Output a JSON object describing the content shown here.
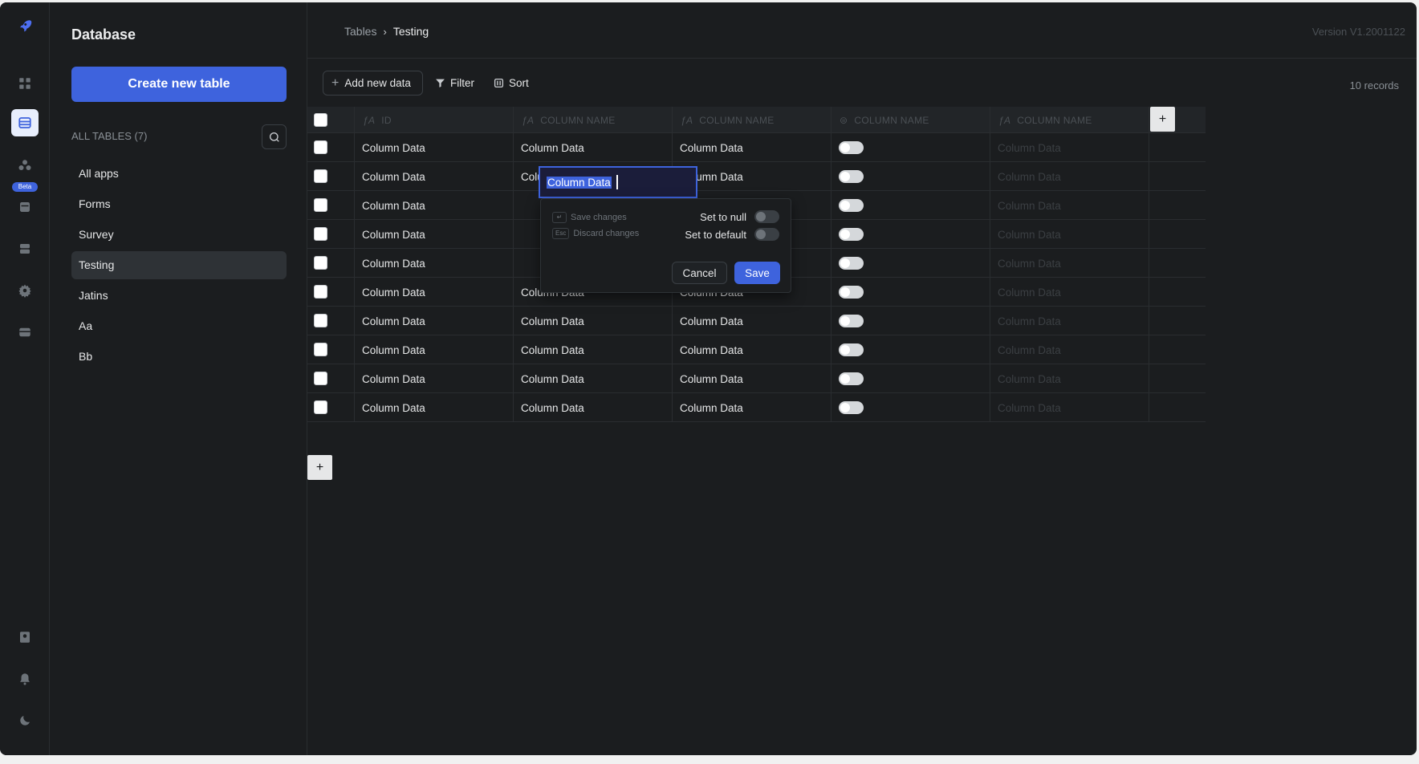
{
  "sidebar": {
    "title": "Database",
    "create_button": "Create new table",
    "all_tables_label": "ALL TABLES (7)",
    "items": [
      {
        "label": "All apps"
      },
      {
        "label": "Forms"
      },
      {
        "label": "Survey"
      },
      {
        "label": "Testing",
        "active": true
      },
      {
        "label": "Jatins"
      },
      {
        "label": "Aa"
      },
      {
        "label": "Bb"
      }
    ]
  },
  "rail": {
    "beta_badge": "Beta",
    "icons": [
      "rocket-logo-icon",
      "apps-grid-icon",
      "database-icon",
      "workflows-icon",
      "storage-icon",
      "server-icon",
      "settings-gear-icon",
      "marketplace-icon",
      "profile-icon",
      "bell-icon",
      "theme-moon-icon"
    ]
  },
  "header": {
    "breadcrumb_root": "Tables",
    "breadcrumb_current": "Testing",
    "version": "Version V1.2001122"
  },
  "toolbar": {
    "add_label": "Add new data",
    "filter_label": "Filter",
    "sort_label": "Sort",
    "records": "10 records"
  },
  "table": {
    "columns": [
      {
        "label": "ID"
      },
      {
        "label": "COLUMN NAME"
      },
      {
        "label": "COLUMN NAME"
      },
      {
        "label": "COLUMN NAME"
      },
      {
        "label": "COLUMN NAME"
      }
    ],
    "cell_text": "Column Data",
    "faded_text": "Column Data",
    "rows": [
      {
        "c1": "Column Data",
        "c2": "Column Data",
        "c3": "Column Data",
        "c5": "Column Data"
      },
      {
        "c1": "Column Data",
        "c2": "Column Data",
        "c3": "Column Data",
        "c5": "Column Data"
      },
      {
        "c1": "Column Data",
        "c2": "",
        "c3": "",
        "c5": "Column Data"
      },
      {
        "c1": "Column Data",
        "c2": "",
        "c3": "",
        "c5": "Column Data"
      },
      {
        "c1": "Column Data",
        "c2": "",
        "c3": "",
        "c5": "Column Data"
      },
      {
        "c1": "Column Data",
        "c2": "Column Data",
        "c3": "Column Data",
        "c5": "Column Data"
      },
      {
        "c1": "Column Data",
        "c2": "Column Data",
        "c3": "Column Data",
        "c5": "Column Data"
      },
      {
        "c1": "Column Data",
        "c2": "Column Data",
        "c3": "Column Data",
        "c5": "Column Data"
      },
      {
        "c1": "Column Data",
        "c2": "Column Data",
        "c3": "Column Data",
        "c5": "Column Data"
      },
      {
        "c1": "Column Data",
        "c2": "Column Data",
        "c3": "Column Data",
        "c5": "Column Data"
      }
    ]
  },
  "editor": {
    "value": "Column Data",
    "hint_save_key": "↵",
    "hint_save": "Save changes",
    "hint_discard_key": "Esc",
    "hint_discard": "Discard changes",
    "set_null": "Set to null",
    "set_default": "Set to default",
    "cancel": "Cancel",
    "save": "Save"
  },
  "colors": {
    "accent": "#3e63dd",
    "background": "#1b1d1f"
  }
}
